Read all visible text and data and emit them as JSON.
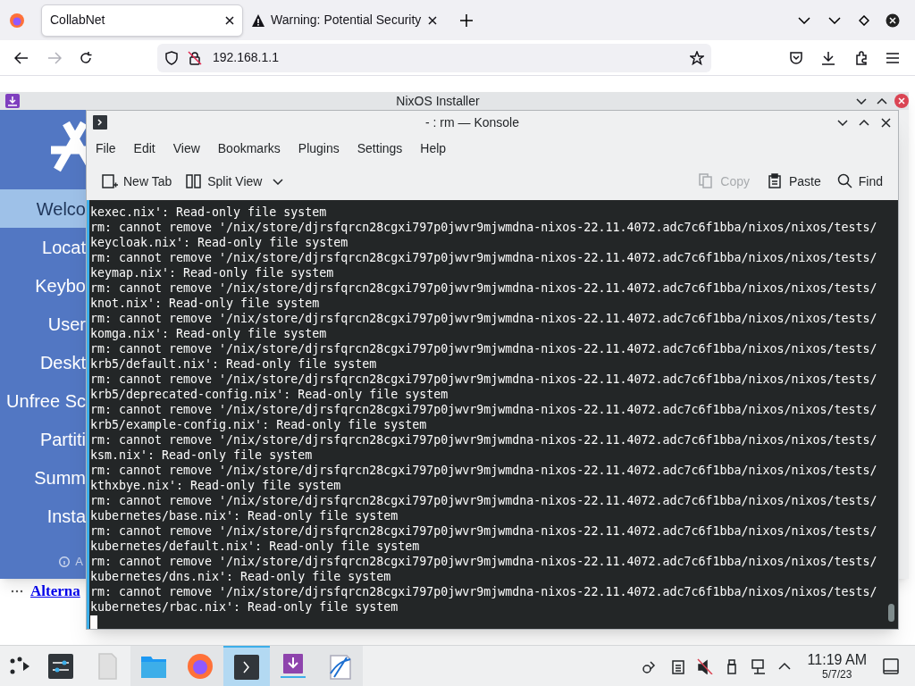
{
  "browser": {
    "tabs": [
      {
        "label": "CollabNet",
        "selected": true,
        "kind": "page"
      },
      {
        "label": "Warning: Potential Security",
        "selected": false,
        "kind": "warning"
      }
    ],
    "url": "192.168.1.1",
    "page_link": "Alterna"
  },
  "installer": {
    "title": "NixOS Installer",
    "steps": [
      {
        "label": "Welco",
        "selected": true
      },
      {
        "label": "Locat",
        "selected": false
      },
      {
        "label": "Keybo",
        "selected": false
      },
      {
        "label": "User",
        "selected": false
      },
      {
        "label": "Deskt",
        "selected": false
      },
      {
        "label": "Unfree Sc",
        "selected": false
      },
      {
        "label": "Partiti",
        "selected": false
      },
      {
        "label": "Summ",
        "selected": false
      },
      {
        "label": "Insta",
        "selected": false
      }
    ],
    "about_label": "A"
  },
  "konsole": {
    "title": "- : rm — Konsole",
    "menu": [
      "File",
      "Edit",
      "View",
      "Bookmarks",
      "Plugins",
      "Settings",
      "Help"
    ],
    "toolbar_left": [
      {
        "label": "New Tab",
        "kind": "new-tab",
        "disabled": false
      },
      {
        "label": "Split View",
        "kind": "split",
        "disabled": false
      }
    ],
    "toolbar_right": [
      {
        "label": "Copy",
        "kind": "copy",
        "disabled": true
      },
      {
        "label": "Paste",
        "kind": "paste",
        "disabled": false
      },
      {
        "label": "Find",
        "kind": "find",
        "disabled": false
      }
    ],
    "lines": [
      "kexec.nix': Read-only file system",
      "rm: cannot remove '/nix/store/djrsfqrcn28cgxi797p0jwvr9mjwmdna-nixos-22.11.4072.adc7c6f1bba/nixos/nixos/tests/",
      "keycloak.nix': Read-only file system",
      "rm: cannot remove '/nix/store/djrsfqrcn28cgxi797p0jwvr9mjwmdna-nixos-22.11.4072.adc7c6f1bba/nixos/nixos/tests/",
      "keymap.nix': Read-only file system",
      "rm: cannot remove '/nix/store/djrsfqrcn28cgxi797p0jwvr9mjwmdna-nixos-22.11.4072.adc7c6f1bba/nixos/nixos/tests/",
      "knot.nix': Read-only file system",
      "rm: cannot remove '/nix/store/djrsfqrcn28cgxi797p0jwvr9mjwmdna-nixos-22.11.4072.adc7c6f1bba/nixos/nixos/tests/",
      "komga.nix': Read-only file system",
      "rm: cannot remove '/nix/store/djrsfqrcn28cgxi797p0jwvr9mjwmdna-nixos-22.11.4072.adc7c6f1bba/nixos/nixos/tests/",
      "krb5/default.nix': Read-only file system",
      "rm: cannot remove '/nix/store/djrsfqrcn28cgxi797p0jwvr9mjwmdna-nixos-22.11.4072.adc7c6f1bba/nixos/nixos/tests/",
      "krb5/deprecated-config.nix': Read-only file system",
      "rm: cannot remove '/nix/store/djrsfqrcn28cgxi797p0jwvr9mjwmdna-nixos-22.11.4072.adc7c6f1bba/nixos/nixos/tests/",
      "krb5/example-config.nix': Read-only file system",
      "rm: cannot remove '/nix/store/djrsfqrcn28cgxi797p0jwvr9mjwmdna-nixos-22.11.4072.adc7c6f1bba/nixos/nixos/tests/",
      "ksm.nix': Read-only file system",
      "rm: cannot remove '/nix/store/djrsfqrcn28cgxi797p0jwvr9mjwmdna-nixos-22.11.4072.adc7c6f1bba/nixos/nixos/tests/",
      "kthxbye.nix': Read-only file system",
      "rm: cannot remove '/nix/store/djrsfqrcn28cgxi797p0jwvr9mjwmdna-nixos-22.11.4072.adc7c6f1bba/nixos/nixos/tests/",
      "kubernetes/base.nix': Read-only file system",
      "rm: cannot remove '/nix/store/djrsfqrcn28cgxi797p0jwvr9mjwmdna-nixos-22.11.4072.adc7c6f1bba/nixos/nixos/tests/",
      "kubernetes/default.nix': Read-only file system",
      "rm: cannot remove '/nix/store/djrsfqrcn28cgxi797p0jwvr9mjwmdna-nixos-22.11.4072.adc7c6f1bba/nixos/nixos/tests/",
      "kubernetes/dns.nix': Read-only file system",
      "rm: cannot remove '/nix/store/djrsfqrcn28cgxi797p0jwvr9mjwmdna-nixos-22.11.4072.adc7c6f1bba/nixos/nixos/tests/",
      "kubernetes/rbac.nix': Read-only file system"
    ]
  },
  "taskbar": {
    "apps": [
      {
        "kind": "settings",
        "selected": false
      },
      {
        "kind": "file",
        "selected": false
      },
      {
        "kind": "folder",
        "selected": false
      },
      {
        "kind": "firefox",
        "selected": false
      },
      {
        "kind": "terminal",
        "selected": true
      },
      {
        "kind": "installer",
        "selected": false
      },
      {
        "kind": "drawing",
        "selected": false
      }
    ],
    "time": "11:19 AM",
    "date": "5/7/23"
  }
}
